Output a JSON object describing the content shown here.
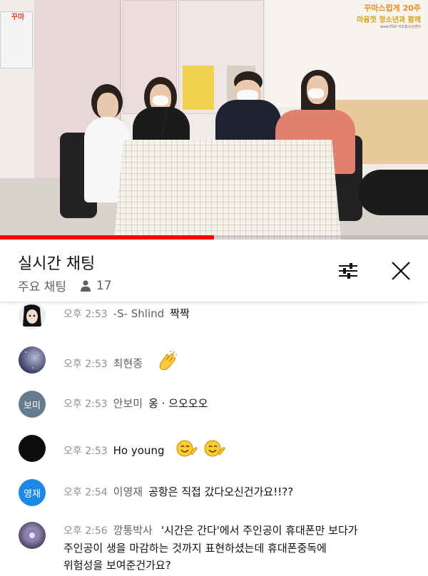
{
  "video": {
    "badge_left": "꾸마",
    "banner": {
      "line1": "꾸마스럽게 20주",
      "line2": "마음껏 청소년과 함께",
      "line3": "www.TGP 서초청소년센터"
    },
    "progress_fraction": 0.5,
    "progress_color": "#ff0000"
  },
  "chat": {
    "title": "실시간 채팅",
    "mode": "주요 채팅",
    "viewer_count": "17",
    "icons": {
      "viewer": "person-icon",
      "filter": "sliders-icon",
      "close": "close-icon"
    }
  },
  "messages": [
    {
      "time": "오후 2:53",
      "author": "-S- Shlind",
      "text": "짝짝",
      "avatar_type": "photo",
      "avatar_color": "#e9e9e9"
    },
    {
      "time": "오후 2:53",
      "author": "최현종",
      "text": "",
      "emoji": [
        "clapping-hands"
      ],
      "avatar_type": "photo",
      "avatar_color": "#3b4170"
    },
    {
      "time": "오후 2:53",
      "author": "안보미",
      "text": "옹 · 으오오오",
      "avatar_type": "initials",
      "avatar_initials": "보미",
      "avatar_color": "#667b8e"
    },
    {
      "time": "오후 2:53",
      "author": "Ho young",
      "text": "",
      "emoji": [
        "smiling-face",
        "smiling-face"
      ],
      "avatar_type": "photo",
      "avatar_color": "#0d0d0d"
    },
    {
      "time": "오후 2:54",
      "author": "이영재",
      "text": "공항은 직접 갔다오신건가요!!??",
      "avatar_type": "initials",
      "avatar_initials": "영재",
      "avatar_color": "#1e88e5"
    },
    {
      "time": "오후 2:56",
      "author": "깡통박사",
      "text": "'시간은 간다'에서 주인공이 휴대폰만 보다가",
      "text_cont1": "주인공이 생을 마감하는 것까지 표현하셨는데 휴대폰중독에",
      "text_cont2": "위험성을 보여준건가요?",
      "avatar_type": "photo",
      "avatar_color": "#6d5f8c"
    }
  ]
}
